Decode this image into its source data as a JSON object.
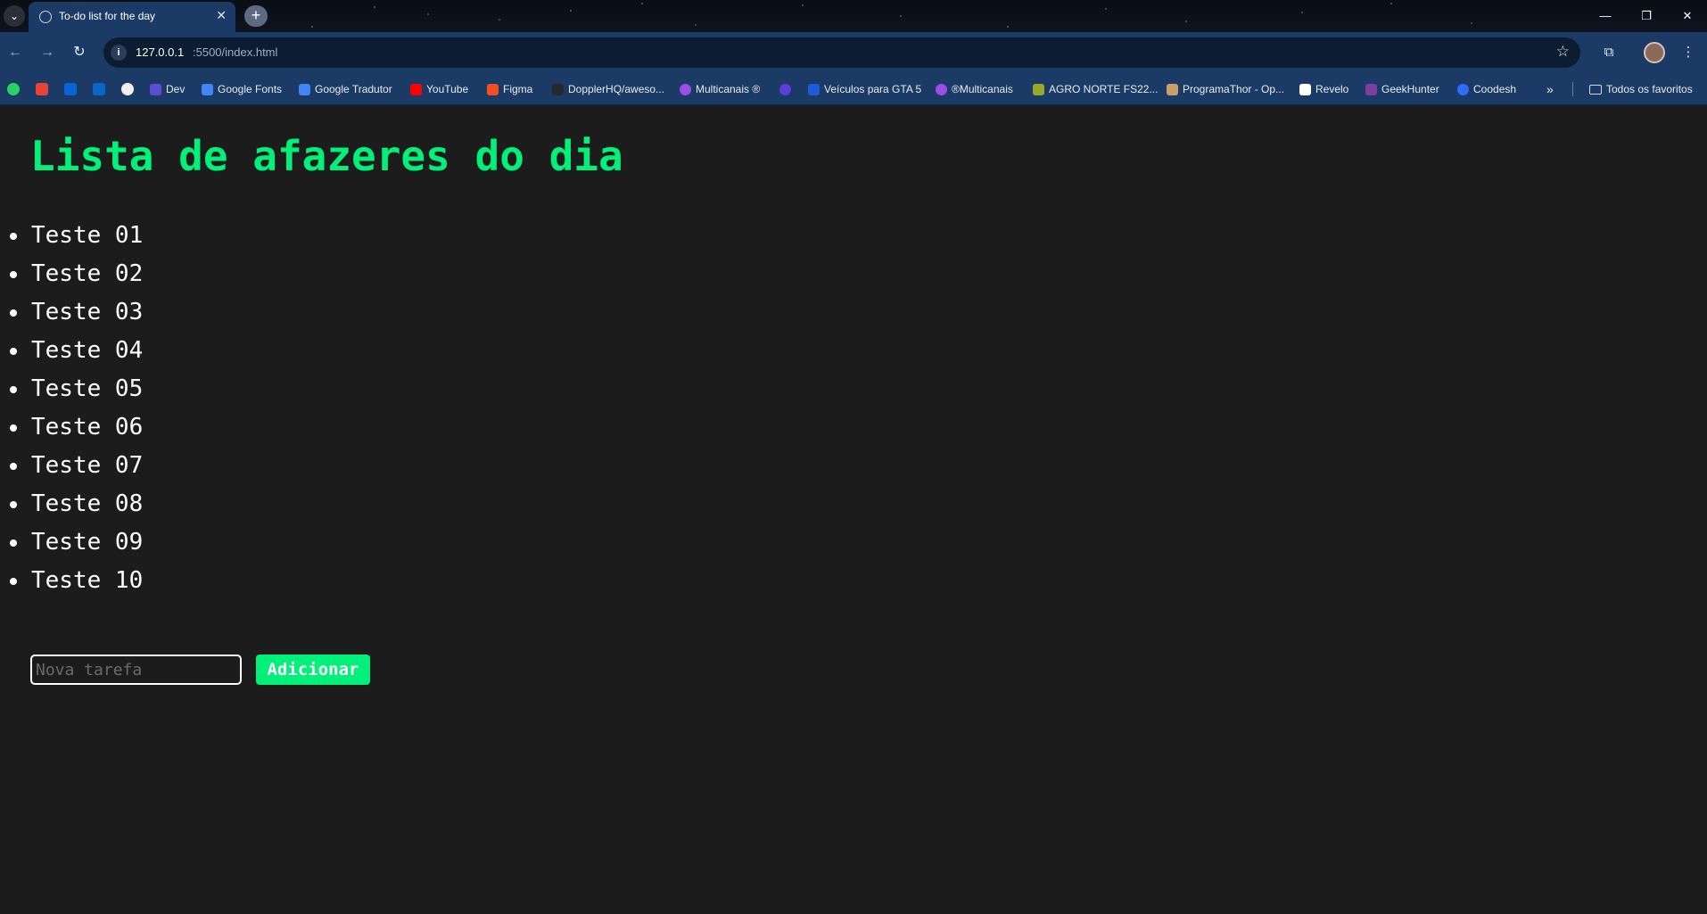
{
  "browser": {
    "tab_title": "To-do list for the day",
    "url_host": "127.0.0.1",
    "url_path": ":5500/index.html",
    "bookmarks": [
      {
        "label": "Dev",
        "color": "#5a4fcf"
      },
      {
        "label": "Google Fonts",
        "color": "#4285f4"
      },
      {
        "label": "Google Tradutor",
        "color": "#4285f4"
      },
      {
        "label": "YouTube",
        "color": "#ff0000"
      },
      {
        "label": "Figma",
        "color": "#f24e1e"
      },
      {
        "label": "DopplerHQ/aweso...",
        "color": "#24292e"
      },
      {
        "label": "Multicanais ®",
        "color": "#9c4de6"
      },
      {
        "label": "",
        "color": "#5a3fd8"
      },
      {
        "label": "Veículos para GTA 5",
        "color": "#1d5bd8"
      },
      {
        "label": "®Multicanais",
        "color": "#9c4de6"
      },
      {
        "label": "AGRO NORTE FS22...",
        "color": "#9aa82a"
      },
      {
        "label": "ProgramaThor - Op...",
        "color": "#c9a06a"
      },
      {
        "label": "Revelo",
        "color": "#ffffff"
      },
      {
        "label": "GeekHunter",
        "color": "#7b3fa0"
      },
      {
        "label": "Coodesh",
        "color": "#2f6bff"
      }
    ],
    "all_bookmarks_label": "Todos os favoritos"
  },
  "page": {
    "title": "Lista de afazeres do dia",
    "tasks": [
      "Teste 01",
      "Teste 02",
      "Teste 03",
      "Teste 04",
      "Teste 05",
      "Teste 06",
      "Teste 07",
      "Teste 08",
      "Teste 09",
      "Teste 10"
    ],
    "input_placeholder": "Nova tarefa",
    "add_button_label": "Adicionar"
  },
  "colors": {
    "accent": "#00f07a",
    "background": "#1c1c1c",
    "text": "#ffffff"
  }
}
